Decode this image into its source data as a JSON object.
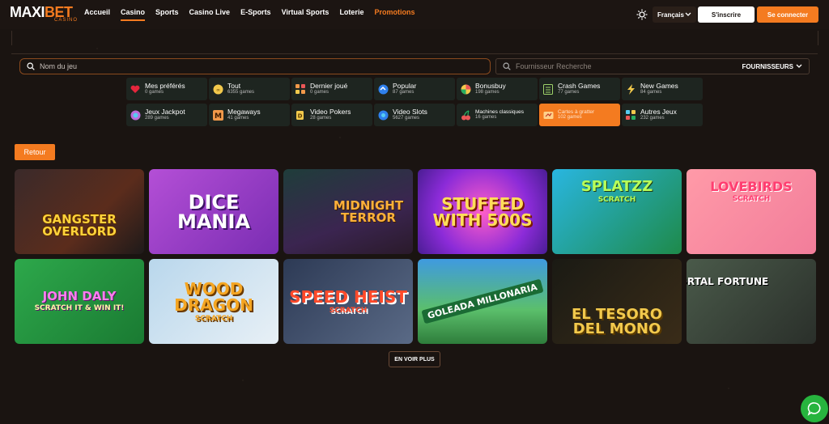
{
  "logo": {
    "maxi": "MAXI",
    "bet": "BET",
    "sub": "CASINO"
  },
  "nav": [
    {
      "label": "Accueil"
    },
    {
      "label": "Casino",
      "active": true
    },
    {
      "label": "Sports"
    },
    {
      "label": "Casino Live"
    },
    {
      "label": "E-Sports"
    },
    {
      "label": "Virtual Sports"
    },
    {
      "label": "Loterie"
    },
    {
      "label": "Promotions",
      "promo": true
    }
  ],
  "header": {
    "language": "Français",
    "signup_label": "S'inscrire",
    "login_label": "Se connecter"
  },
  "search": {
    "game_placeholder": "Nom du jeu",
    "provider_placeholder": "Fournisseur Recherche",
    "providers_label": "FOURNISSEURS"
  },
  "categories": [
    {
      "name": "Mes préférés",
      "count": "0 games",
      "icon": "heart-icon"
    },
    {
      "name": "Tout",
      "count": "6355 games",
      "icon": "all-icon"
    },
    {
      "name": "Dernier joué",
      "count": "0 games",
      "icon": "grid-icon"
    },
    {
      "name": "Popular",
      "count": "87 games",
      "icon": "popular-icon"
    },
    {
      "name": "Bonusbuy",
      "count": "198 games",
      "icon": "bonusbuy-icon"
    },
    {
      "name": "Crash Games",
      "count": "77 games",
      "icon": "crash-icon"
    },
    {
      "name": "New Games",
      "count": "84 games",
      "icon": "lightning-icon"
    },
    {
      "name": "Jeux Jackpot",
      "count": "289 games",
      "icon": "jackpot-icon"
    },
    {
      "name": "Megaways",
      "count": "41 games",
      "icon": "megaways-icon"
    },
    {
      "name": "Video Pokers",
      "count": "28 games",
      "icon": "poker-icon"
    },
    {
      "name": "Video Slots",
      "count": "5627 games",
      "icon": "slots-icon"
    },
    {
      "name": "Machines classiques",
      "count": "16 games",
      "icon": "cherry-icon",
      "small": true
    },
    {
      "name": "Cartes à gratter",
      "count": "102 games",
      "icon": "scratch-icon",
      "small": true,
      "active": true
    },
    {
      "name": "Autres Jeux",
      "count": "232 games",
      "icon": "other-games-icon"
    }
  ],
  "back_label": "Retour",
  "games": [
    {
      "title": "Gangster Overlord",
      "sub": ""
    },
    {
      "title": "Dice Mania",
      "sub": ""
    },
    {
      "title": "Midnight Terror",
      "sub": ""
    },
    {
      "title": "Stuffed with 500s",
      "sub": ""
    },
    {
      "title": "Splatzz",
      "sub": "Scratch"
    },
    {
      "title": "Lovebirds",
      "sub": "Scratch"
    },
    {
      "title": "John Daly",
      "sub": "Scratch it & win it!"
    },
    {
      "title": "Wood Dragon",
      "sub": "Scratch"
    },
    {
      "title": "Speed Heist",
      "sub": "Scratch"
    },
    {
      "title": "Goleada Millonaria",
      "sub": ""
    },
    {
      "title": "El Tesoro del Mono",
      "sub": ""
    },
    {
      "title": "Mortal Fortune",
      "sub": ""
    }
  ],
  "more_label": "EN VOIR PLUS",
  "colors": {
    "accent": "#f47b20",
    "background": "#1a1411",
    "chat": "#27b43e"
  }
}
